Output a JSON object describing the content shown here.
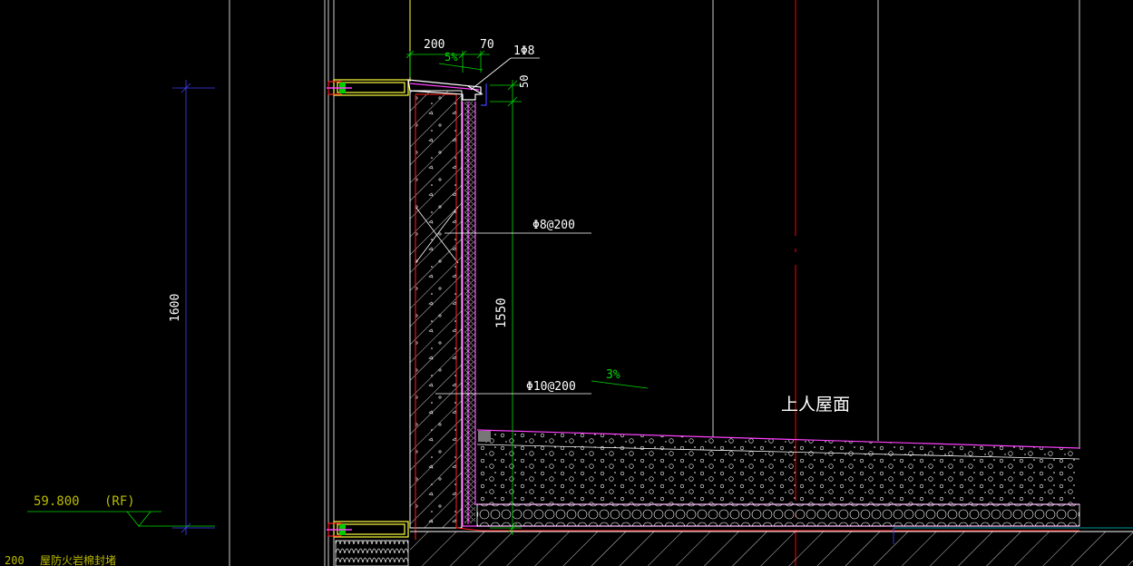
{
  "drawing": {
    "colors": {
      "background": "#000000",
      "dimension": "#00dd00",
      "annotation": "#ffffff",
      "wall_hatch": "#ffffff",
      "section_red": "#ff2020",
      "membrane": "#ff40ff",
      "window_frame": "#ffff40",
      "grid_blue": "#4040ff",
      "level_mark": "#bbbb00",
      "axis_red": "#ff0000"
    },
    "dimensions": {
      "parapet_top_width": "200",
      "coping_overhang": "70",
      "coping_slope": "5%",
      "coping_rebar": "1Φ8",
      "coping_thickness": "50",
      "parapet_inner_height": "1550",
      "total_height": "1600",
      "roof_slope": "3%"
    },
    "annotations": {
      "horizontal_rebar": "Φ8@200",
      "vertical_rebar": "Φ10@200",
      "roof_label": "上人屋面"
    },
    "level": {
      "elevation": "59.800",
      "floor": "(RF)"
    },
    "footer_note": {
      "code": "200",
      "text": "屋防火岩棉封堵"
    }
  }
}
